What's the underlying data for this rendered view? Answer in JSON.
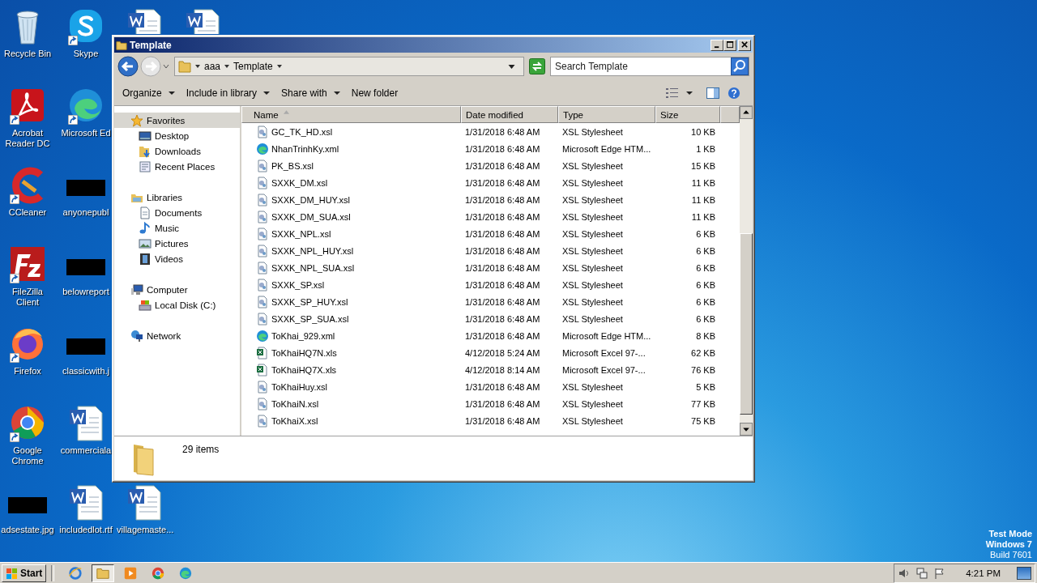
{
  "desktop": {
    "columns": [
      [
        {
          "kind": "recycle",
          "label": "Recycle Bin",
          "shortcut": false
        },
        {
          "kind": "acrobat",
          "label": "Acrobat Reader DC",
          "shortcut": true
        },
        {
          "kind": "ccleaner",
          "label": "CCleaner",
          "shortcut": true
        },
        {
          "kind": "filezilla",
          "label": "FileZilla Client",
          "shortcut": true
        },
        {
          "kind": "firefox",
          "label": "Firefox",
          "shortcut": true
        },
        {
          "kind": "chrome",
          "label": "Google Chrome",
          "shortcut": true
        },
        {
          "kind": "thumbnail",
          "label": "adsestate.jpg",
          "shortcut": false
        }
      ],
      [
        {
          "kind": "skype",
          "label": "Skype",
          "shortcut": true
        },
        {
          "kind": "edge",
          "label": "Microsoft Ed",
          "shortcut": true
        },
        {
          "kind": "thumbnail",
          "label": "anyonepubl",
          "shortcut": false
        },
        {
          "kind": "thumbnail",
          "label": "belowreport",
          "shortcut": false
        },
        {
          "kind": "thumbnail",
          "label": "classicwith.j",
          "shortcut": false
        },
        {
          "kind": "word",
          "label": "commerciala",
          "shortcut": false
        },
        {
          "kind": "word",
          "label": "includedlot.rtf",
          "shortcut": false
        }
      ],
      [
        {
          "kind": "word",
          "shortcut": false
        },
        {
          "kind": "word",
          "label": "villagemaste...",
          "shortcut": false
        }
      ],
      [
        {
          "kind": "word",
          "shortcut": false
        }
      ]
    ],
    "os_notice": [
      "Test Mode",
      "Windows 7",
      "Build 7601"
    ]
  },
  "window": {
    "title": "Template",
    "address": {
      "crumbs": [
        "aaa",
        "Template"
      ]
    },
    "search": {
      "placeholder": "Search Template"
    },
    "toolbar": [
      {
        "label": "Organize",
        "menu": true
      },
      {
        "label": "Include in library",
        "menu": true
      },
      {
        "label": "Share with",
        "menu": true
      },
      {
        "label": "New folder",
        "menu": false
      }
    ],
    "nav": [
      {
        "label": "Favorites",
        "kind": "star",
        "selected": true,
        "children": [
          {
            "label": "Desktop",
            "kind": "desktop",
            "selected": false
          },
          {
            "label": "Downloads",
            "kind": "downloads",
            "selected": false
          },
          {
            "label": "Recent Places",
            "kind": "recent",
            "selected": false
          }
        ]
      },
      {
        "label": "Libraries",
        "kind": "library",
        "selected": false,
        "children": [
          {
            "label": "Documents",
            "kind": "documents",
            "selected": false
          },
          {
            "label": "Music",
            "kind": "music",
            "selected": false
          },
          {
            "label": "Pictures",
            "kind": "pictures",
            "selected": false
          },
          {
            "label": "Videos",
            "kind": "videos",
            "selected": false
          }
        ]
      },
      {
        "label": "Computer",
        "kind": "computer",
        "selected": false,
        "children": [
          {
            "label": "Local Disk (C:)",
            "kind": "disk",
            "selected": false
          }
        ]
      },
      {
        "label": "Network",
        "kind": "network",
        "selected": false
      }
    ],
    "columns": [
      {
        "label": "Name",
        "sorted": true
      },
      {
        "label": "Date modified",
        "sorted": false
      },
      {
        "label": "Type",
        "sorted": false
      },
      {
        "label": "Size",
        "sorted": false
      }
    ],
    "files": [
      {
        "name": "GC_TK_HD.xsl",
        "date": "1/31/2018 6:48 AM",
        "type": "XSL Stylesheet",
        "size": "10 KB",
        "kind": "xsl"
      },
      {
        "name": "NhanTrinhKy.xml",
        "date": "1/31/2018 6:48 AM",
        "type": "Microsoft Edge HTM...",
        "size": "1 KB",
        "kind": "edge"
      },
      {
        "name": "PK_BS.xsl",
        "date": "1/31/2018 6:48 AM",
        "type": "XSL Stylesheet",
        "size": "15 KB",
        "kind": "xsl"
      },
      {
        "name": "SXXK_DM.xsl",
        "date": "1/31/2018 6:48 AM",
        "type": "XSL Stylesheet",
        "size": "11 KB",
        "kind": "xsl"
      },
      {
        "name": "SXXK_DM_HUY.xsl",
        "date": "1/31/2018 6:48 AM",
        "type": "XSL Stylesheet",
        "size": "11 KB",
        "kind": "xsl"
      },
      {
        "name": "SXXK_DM_SUA.xsl",
        "date": "1/31/2018 6:48 AM",
        "type": "XSL Stylesheet",
        "size": "11 KB",
        "kind": "xsl"
      },
      {
        "name": "SXXK_NPL.xsl",
        "date": "1/31/2018 6:48 AM",
        "type": "XSL Stylesheet",
        "size": "6 KB",
        "kind": "xsl"
      },
      {
        "name": "SXXK_NPL_HUY.xsl",
        "date": "1/31/2018 6:48 AM",
        "type": "XSL Stylesheet",
        "size": "6 KB",
        "kind": "xsl"
      },
      {
        "name": "SXXK_NPL_SUA.xsl",
        "date": "1/31/2018 6:48 AM",
        "type": "XSL Stylesheet",
        "size": "6 KB",
        "kind": "xsl"
      },
      {
        "name": "SXXK_SP.xsl",
        "date": "1/31/2018 6:48 AM",
        "type": "XSL Stylesheet",
        "size": "6 KB",
        "kind": "xsl"
      },
      {
        "name": "SXXK_SP_HUY.xsl",
        "date": "1/31/2018 6:48 AM",
        "type": "XSL Stylesheet",
        "size": "6 KB",
        "kind": "xsl"
      },
      {
        "name": "SXXK_SP_SUA.xsl",
        "date": "1/31/2018 6:48 AM",
        "type": "XSL Stylesheet",
        "size": "6 KB",
        "kind": "xsl"
      },
      {
        "name": "ToKhai_929.xml",
        "date": "1/31/2018 6:48 AM",
        "type": "Microsoft Edge HTM...",
        "size": "8 KB",
        "kind": "edge"
      },
      {
        "name": "ToKhaiHQ7N.xls",
        "date": "4/12/2018 5:24 AM",
        "type": "Microsoft Excel 97-...",
        "size": "62 KB",
        "kind": "excel"
      },
      {
        "name": "ToKhaiHQ7X.xls",
        "date": "4/12/2018 8:14 AM",
        "type": "Microsoft Excel 97-...",
        "size": "76 KB",
        "kind": "excel"
      },
      {
        "name": "ToKhaiHuy.xsl",
        "date": "1/31/2018 6:48 AM",
        "type": "XSL Stylesheet",
        "size": "5 KB",
        "kind": "xsl"
      },
      {
        "name": "ToKhaiN.xsl",
        "date": "1/31/2018 6:48 AM",
        "type": "XSL Stylesheet",
        "size": "77 KB",
        "kind": "xsl"
      },
      {
        "name": "ToKhaiX.xsl",
        "date": "1/31/2018 6:48 AM",
        "type": "XSL Stylesheet",
        "size": "75 KB",
        "kind": "xsl"
      }
    ],
    "status": {
      "count": "29 items"
    }
  },
  "taskbar": {
    "start": "Start",
    "apps": [
      {
        "kind": "ie",
        "active": false
      },
      {
        "kind": "explorer",
        "active": true
      },
      {
        "kind": "media",
        "active": false
      },
      {
        "kind": "chrome",
        "active": false
      },
      {
        "kind": "edge",
        "active": false
      }
    ],
    "clock": "4:21 PM"
  }
}
